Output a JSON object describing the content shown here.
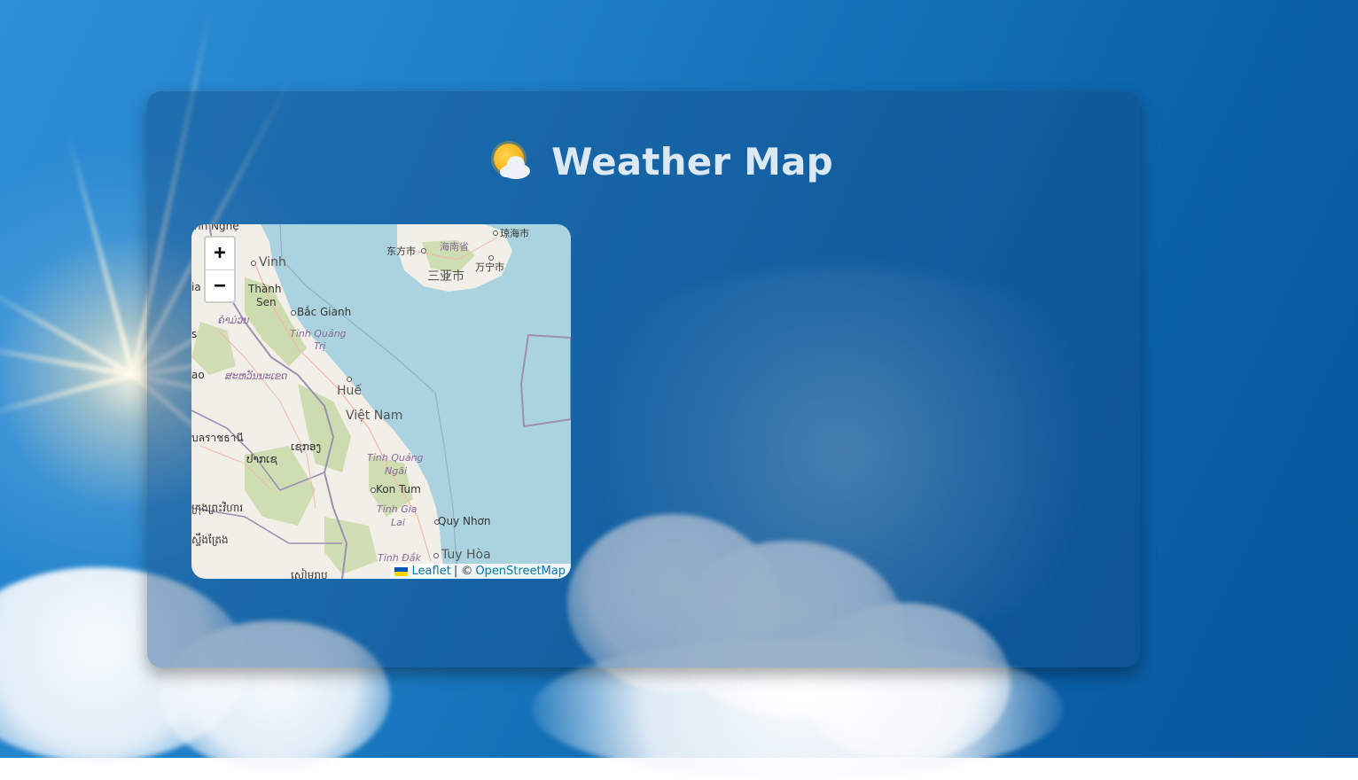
{
  "app": {
    "title": "Weather Map",
    "title_icon": "sun-behind-cloud-icon"
  },
  "map": {
    "zoom_in_label": "+",
    "zoom_out_label": "−",
    "attribution": {
      "leaflet_label": "Leaflet",
      "separator": "| ©",
      "osm_label": "OpenStreetMap"
    },
    "labels": {
      "nghe": "nh Nghệ",
      "vinh": "Vinh",
      "thanh_sen": "Thành",
      "thanh_sen2": "Sen",
      "bac_giang": "Bắc Gianh",
      "lao1": "ຄໍາມ່ວນ",
      "quang_tri": "Tỉnh Quảng",
      "quang_tri2": "Trị",
      "lao2": "ສະຫວັນນະເຂດ",
      "hue": "Huế",
      "viet_nam": "Việt Nam",
      "thai1": "บลราชธานี",
      "lao3": "ເຊກອງ",
      "lao4": "ປາກເຊ",
      "quang_ngai": "Tỉnh Quảng",
      "quang_ngai2": "Ngãi",
      "kon_tum": "Kon Tum",
      "gia_lai": "Tỉnh Gia",
      "gia_lai2": "Lai",
      "quy_nhon": "Quy Nhơn",
      "khmer1": "ក្រុងព្រះវិហារ",
      "khmer2": "ស្ទឹងត្រែង",
      "dak": "Tỉnh Đắk",
      "tuy_hoa": "Tuy Hòa",
      "khmer3": "សៀមរាប",
      "dongfang": "东方市",
      "hainan": "海南省",
      "qionghai": "琼海市",
      "wanning": "万宁市",
      "sanya": "三亚市",
      "edge1": "s",
      "edge2": "ao",
      "edge3": "ia"
    }
  },
  "colors": {
    "sea": "#aad3df",
    "land": "#f2efe9",
    "forest": "#c8d9a8",
    "border": "#9e8fb0",
    "accent_link": "#0078a8"
  }
}
